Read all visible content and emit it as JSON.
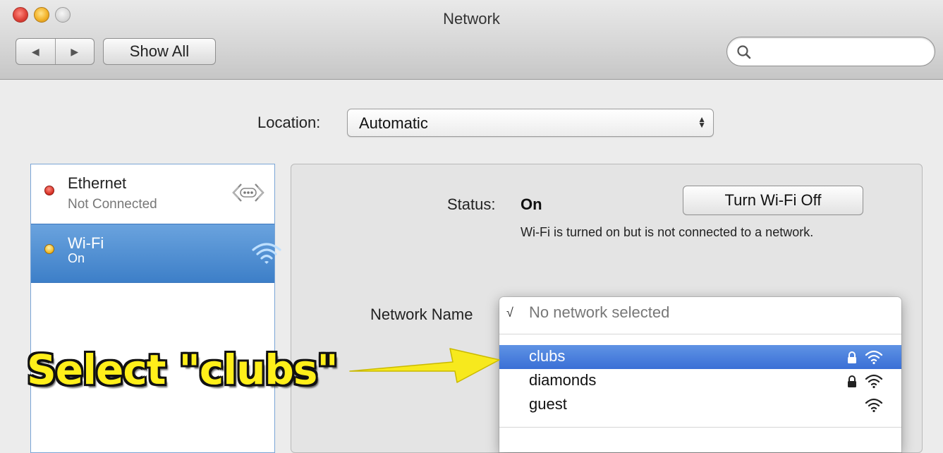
{
  "window": {
    "title": "Network"
  },
  "toolbar": {
    "back_glyph": "◀",
    "forward_glyph": "▶",
    "show_all_label": "Show All",
    "search_placeholder": ""
  },
  "location": {
    "label": "Location:",
    "value": "Automatic"
  },
  "sidebar": {
    "items": [
      {
        "name": "Ethernet",
        "status": "Not Connected",
        "dot_color": "#d42a1e",
        "icon": "ethernet-icon",
        "selected": false
      },
      {
        "name": "Wi-Fi",
        "status": "On",
        "dot_color": "#f0b51c",
        "icon": "wifi-icon",
        "selected": true
      }
    ]
  },
  "detail": {
    "status_label": "Status:",
    "status_value": "On",
    "turn_off_label": "Turn Wi-Fi Off",
    "status_description": "Wi-Fi is turned on but is not connected to a network.",
    "network_name_label": "Network Name"
  },
  "network_menu": {
    "check_glyph": "√",
    "none_label": "No network selected",
    "networks": [
      {
        "name": "clubs",
        "locked": true,
        "highlighted": true
      },
      {
        "name": "diamonds",
        "locked": true,
        "highlighted": false
      },
      {
        "name": "guest",
        "locked": false,
        "highlighted": false
      }
    ]
  },
  "annotation": {
    "text": "Select \"clubs\"",
    "color": "#ffef1a"
  }
}
